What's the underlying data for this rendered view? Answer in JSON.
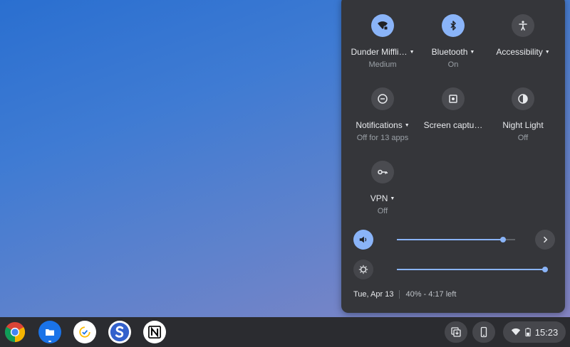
{
  "quick_settings": {
    "tiles": [
      {
        "label": "Dunder Miffli…",
        "sub": "Medium",
        "icon": "wifi-lock-icon",
        "on": true,
        "caret": true
      },
      {
        "label": "Bluetooth",
        "sub": "On",
        "icon": "bluetooth-icon",
        "on": true,
        "caret": true
      },
      {
        "label": "Accessibility",
        "sub": "",
        "icon": "accessibility-icon",
        "on": false,
        "caret": true
      },
      {
        "label": "Notifications",
        "sub": "Off for 13 apps",
        "icon": "do-not-disturb-icon",
        "on": false,
        "caret": true
      },
      {
        "label": "Screen captu…",
        "sub": "",
        "icon": "screen-capture-icon",
        "on": false,
        "caret": false
      },
      {
        "label": "Night Light",
        "sub": "Off",
        "icon": "night-light-icon",
        "on": false,
        "caret": false
      },
      {
        "label": "VPN",
        "sub": "Off",
        "icon": "vpn-key-icon",
        "on": false,
        "caret": true
      }
    ],
    "volume": {
      "level": 0.9
    },
    "brightness": {
      "level": 1.0
    },
    "date": "Tue, Apr 13",
    "battery_text": "40% - 4:17 left"
  },
  "shelf": {
    "apps": [
      "Chrome",
      "Files",
      "Tasks",
      "Simplenote",
      "Notion"
    ],
    "status_time": "15:23"
  },
  "colors": {
    "accent": "#8ab4f8",
    "panel": "#35363a",
    "shelf": "#2b2c30"
  }
}
